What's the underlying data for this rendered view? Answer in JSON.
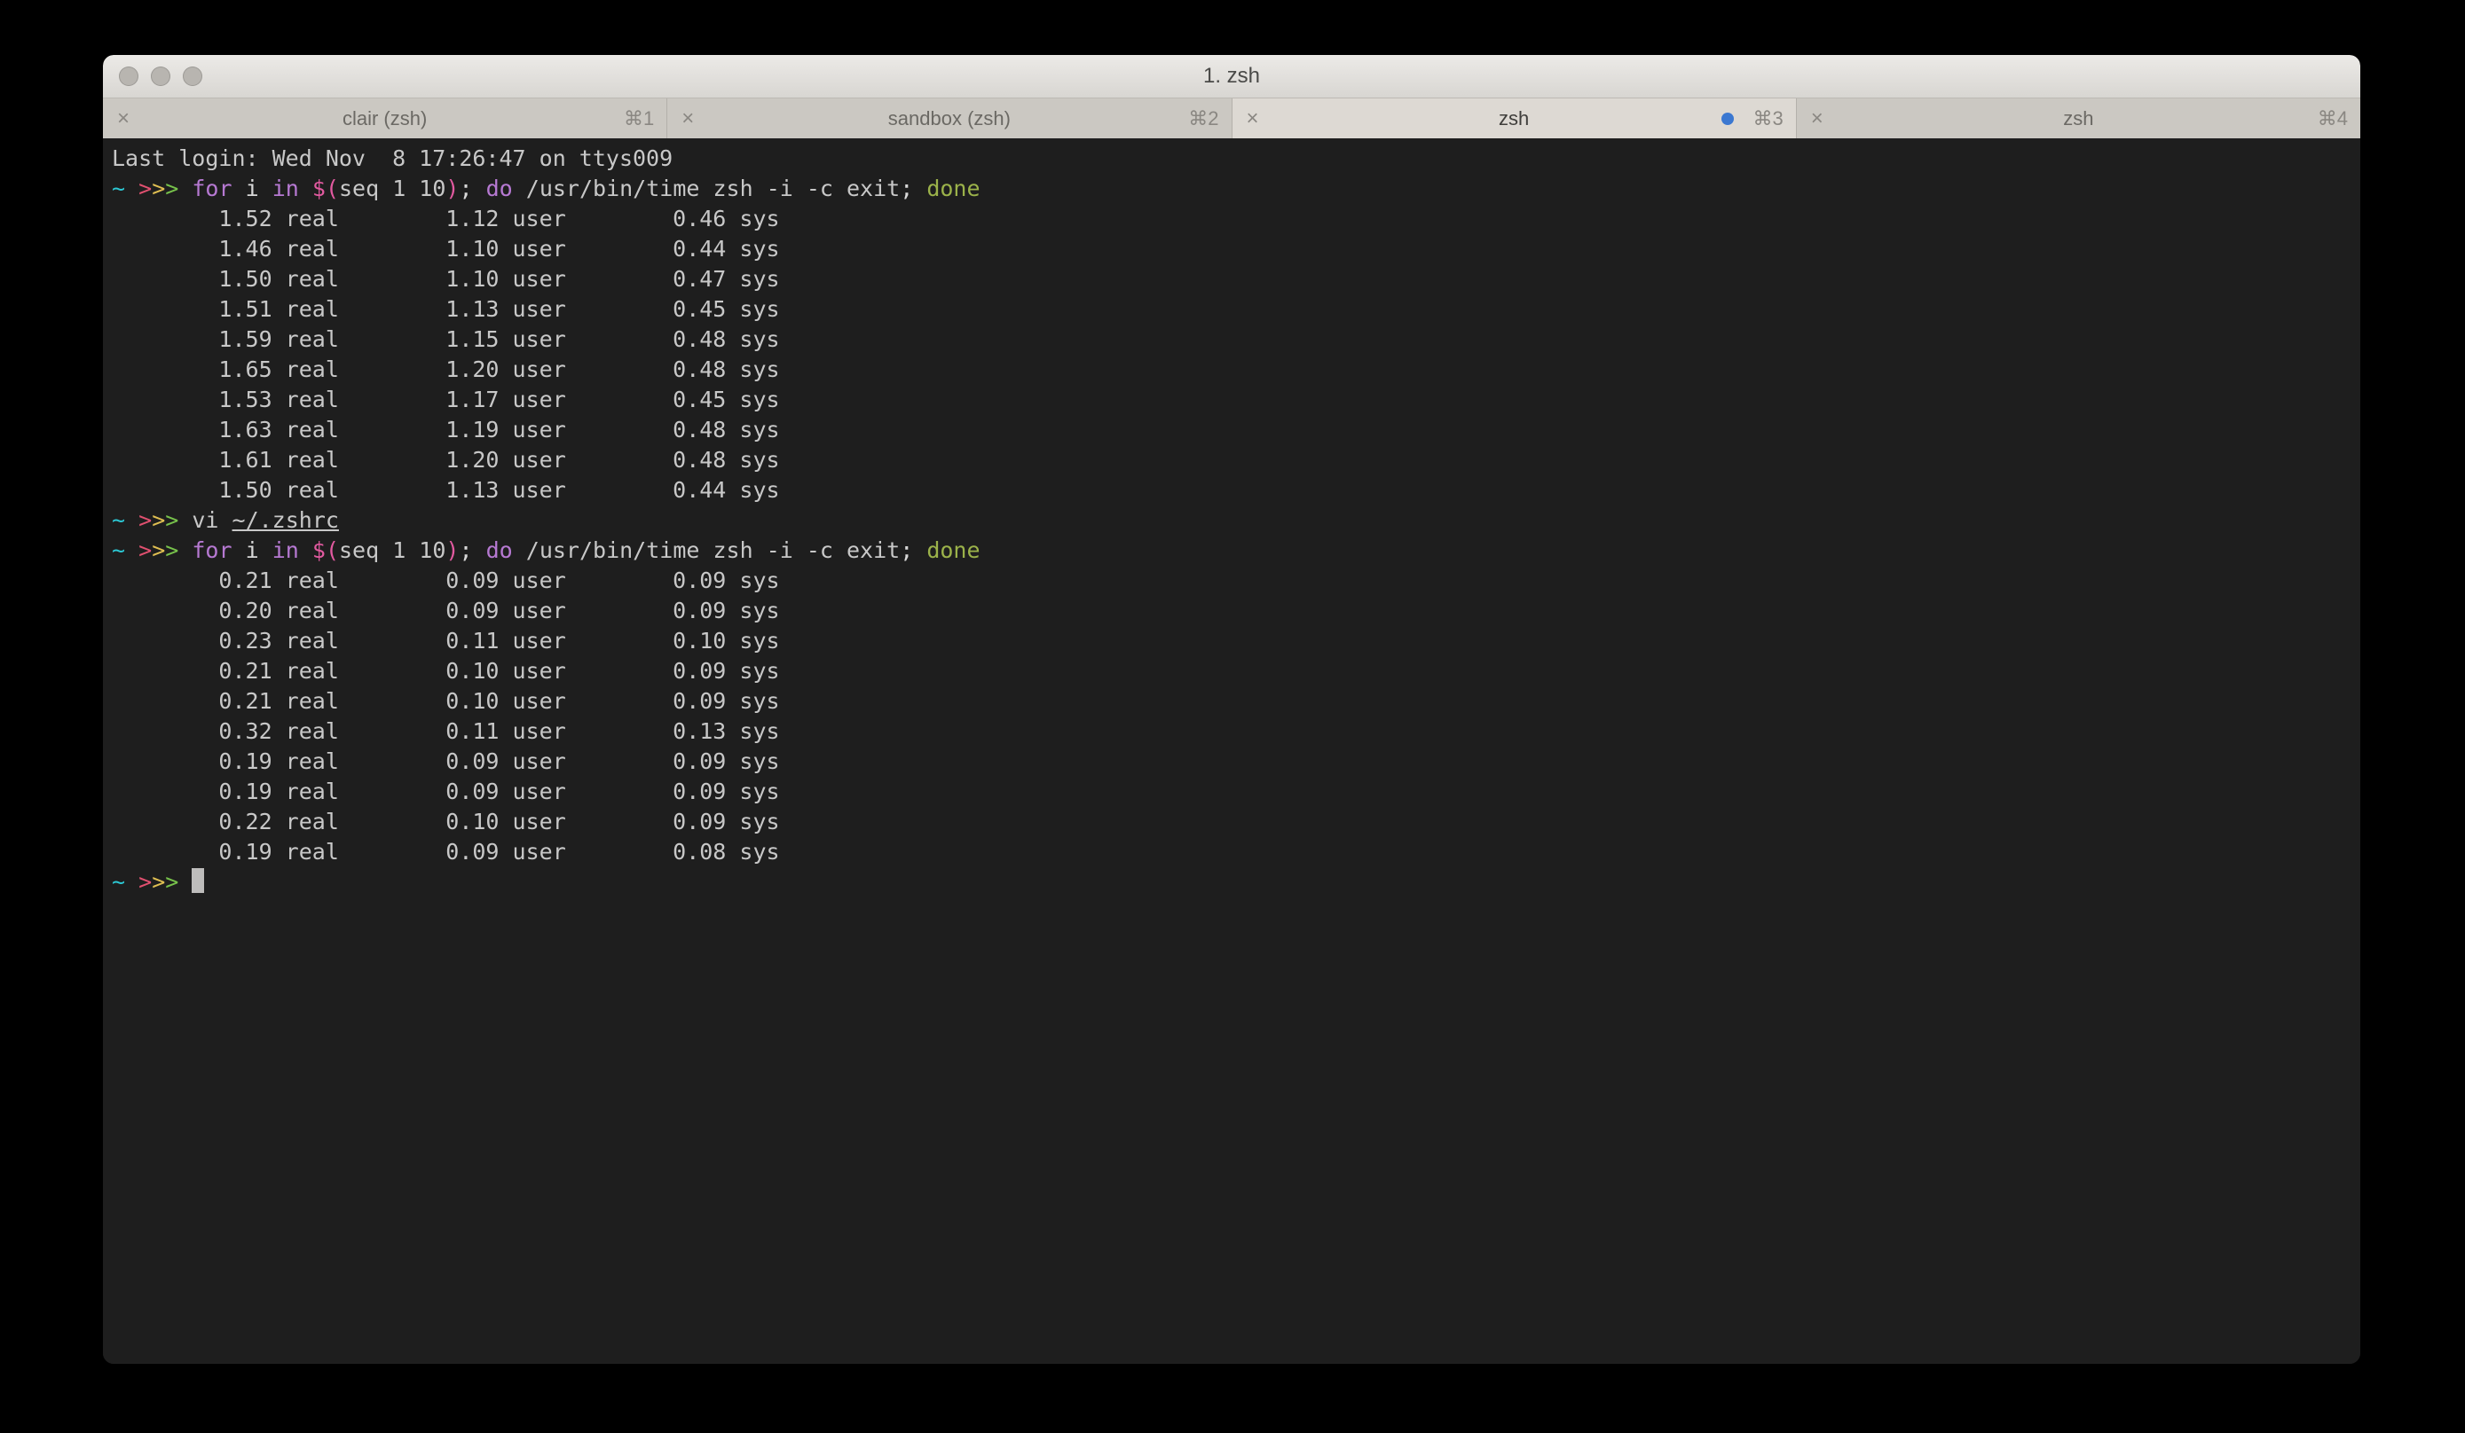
{
  "window": {
    "title": "1. zsh"
  },
  "tabs": [
    {
      "label": "clair (zsh)",
      "shortcut": "⌘1",
      "active": false,
      "dot": false
    },
    {
      "label": "sandbox (zsh)",
      "shortcut": "⌘2",
      "active": false,
      "dot": false
    },
    {
      "label": "zsh",
      "shortcut": "⌘3",
      "active": true,
      "dot": true
    },
    {
      "label": "zsh",
      "shortcut": "⌘4",
      "active": false,
      "dot": false
    }
  ],
  "login_line": "Last login: Wed Nov  8 17:26:47 on ttys009",
  "prompt": {
    "tilde": "~",
    "arrows": ">>>"
  },
  "cmd": {
    "for": "for",
    "i": "i",
    "in": "in",
    "sub_open": "$(",
    "seq": "seq 1 10",
    "sub_close": ")",
    "semi1": ";",
    "do": "do",
    "path": "/usr/bin/time zsh -i -c exit",
    "semi2": ";",
    "done": "done"
  },
  "vi_cmd": {
    "vi": "vi",
    "arg": "~/.zshrc"
  },
  "run1": [
    {
      "real": "1.52",
      "user": "1.12",
      "sys": "0.46"
    },
    {
      "real": "1.46",
      "user": "1.10",
      "sys": "0.44"
    },
    {
      "real": "1.50",
      "user": "1.10",
      "sys": "0.47"
    },
    {
      "real": "1.51",
      "user": "1.13",
      "sys": "0.45"
    },
    {
      "real": "1.59",
      "user": "1.15",
      "sys": "0.48"
    },
    {
      "real": "1.65",
      "user": "1.20",
      "sys": "0.48"
    },
    {
      "real": "1.53",
      "user": "1.17",
      "sys": "0.45"
    },
    {
      "real": "1.63",
      "user": "1.19",
      "sys": "0.48"
    },
    {
      "real": "1.61",
      "user": "1.20",
      "sys": "0.48"
    },
    {
      "real": "1.50",
      "user": "1.13",
      "sys": "0.44"
    }
  ],
  "run2": [
    {
      "real": "0.21",
      "user": "0.09",
      "sys": "0.09"
    },
    {
      "real": "0.20",
      "user": "0.09",
      "sys": "0.09"
    },
    {
      "real": "0.23",
      "user": "0.11",
      "sys": "0.10"
    },
    {
      "real": "0.21",
      "user": "0.10",
      "sys": "0.09"
    },
    {
      "real": "0.21",
      "user": "0.10",
      "sys": "0.09"
    },
    {
      "real": "0.32",
      "user": "0.11",
      "sys": "0.13"
    },
    {
      "real": "0.19",
      "user": "0.09",
      "sys": "0.09"
    },
    {
      "real": "0.19",
      "user": "0.09",
      "sys": "0.09"
    },
    {
      "real": "0.22",
      "user": "0.10",
      "sys": "0.09"
    },
    {
      "real": "0.19",
      "user": "0.09",
      "sys": "0.08"
    }
  ],
  "labels": {
    "real": "real",
    "user": "user",
    "sys": "sys"
  }
}
